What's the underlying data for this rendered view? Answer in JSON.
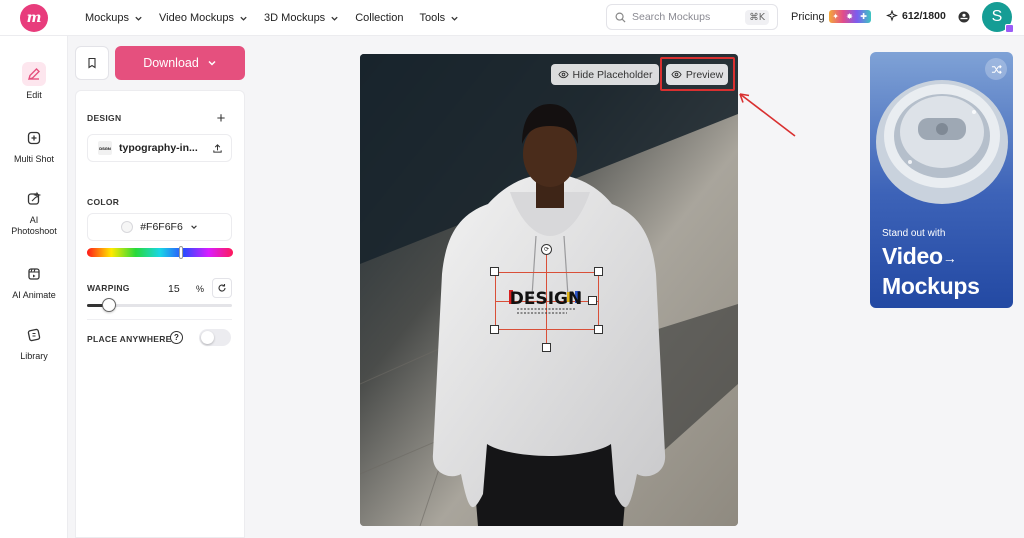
{
  "logo": {
    "text": "m"
  },
  "nav": [
    {
      "label": "Mockups",
      "dropdown": true
    },
    {
      "label": "Video Mockups",
      "dropdown": true
    },
    {
      "label": "3D Mockups",
      "dropdown": true
    },
    {
      "label": "Collection",
      "dropdown": false
    },
    {
      "label": "Tools",
      "dropdown": true
    }
  ],
  "search": {
    "placeholder": "Search Mockups",
    "shortcut": "⌘K"
  },
  "pricing": {
    "label": "Pricing"
  },
  "credits": {
    "value": "612/1800"
  },
  "user": {
    "initial": "S"
  },
  "rail": [
    {
      "label": "Edit",
      "icon": "pencil-icon",
      "active": true
    },
    {
      "label": "Multi Shot",
      "icon": "multi-shot-icon",
      "active": false
    },
    {
      "label": "AI Photoshoot",
      "icon": "ai-photoshoot-icon",
      "active": false
    },
    {
      "label": "AI Animate",
      "icon": "ai-animate-icon",
      "active": false
    },
    {
      "label": "Library",
      "icon": "library-icon",
      "active": false
    }
  ],
  "toolbar": {
    "download_label": "Download"
  },
  "panel": {
    "design_label": "DESIGN",
    "file_name": "typography-in...",
    "color_label": "COLOR",
    "color_value": "#F6F6F6",
    "warping_label": "WARPING",
    "warping_value": "15",
    "warping_unit": "%",
    "warping_level": 0.15,
    "place_anywhere_label": "PLACE ANYWHERE",
    "place_anywhere_on": false
  },
  "canvas": {
    "hide_placeholder_label": "Hide Placeholder",
    "preview_label": "Preview",
    "design_text": "DESIGN"
  },
  "ad": {
    "small_text": "Stand out with",
    "big_line1": "Video",
    "big_line2": "Mockups"
  },
  "colors": {
    "accent": "#e5507e",
    "highlight": "#d93030",
    "avatar": "#159d95"
  }
}
